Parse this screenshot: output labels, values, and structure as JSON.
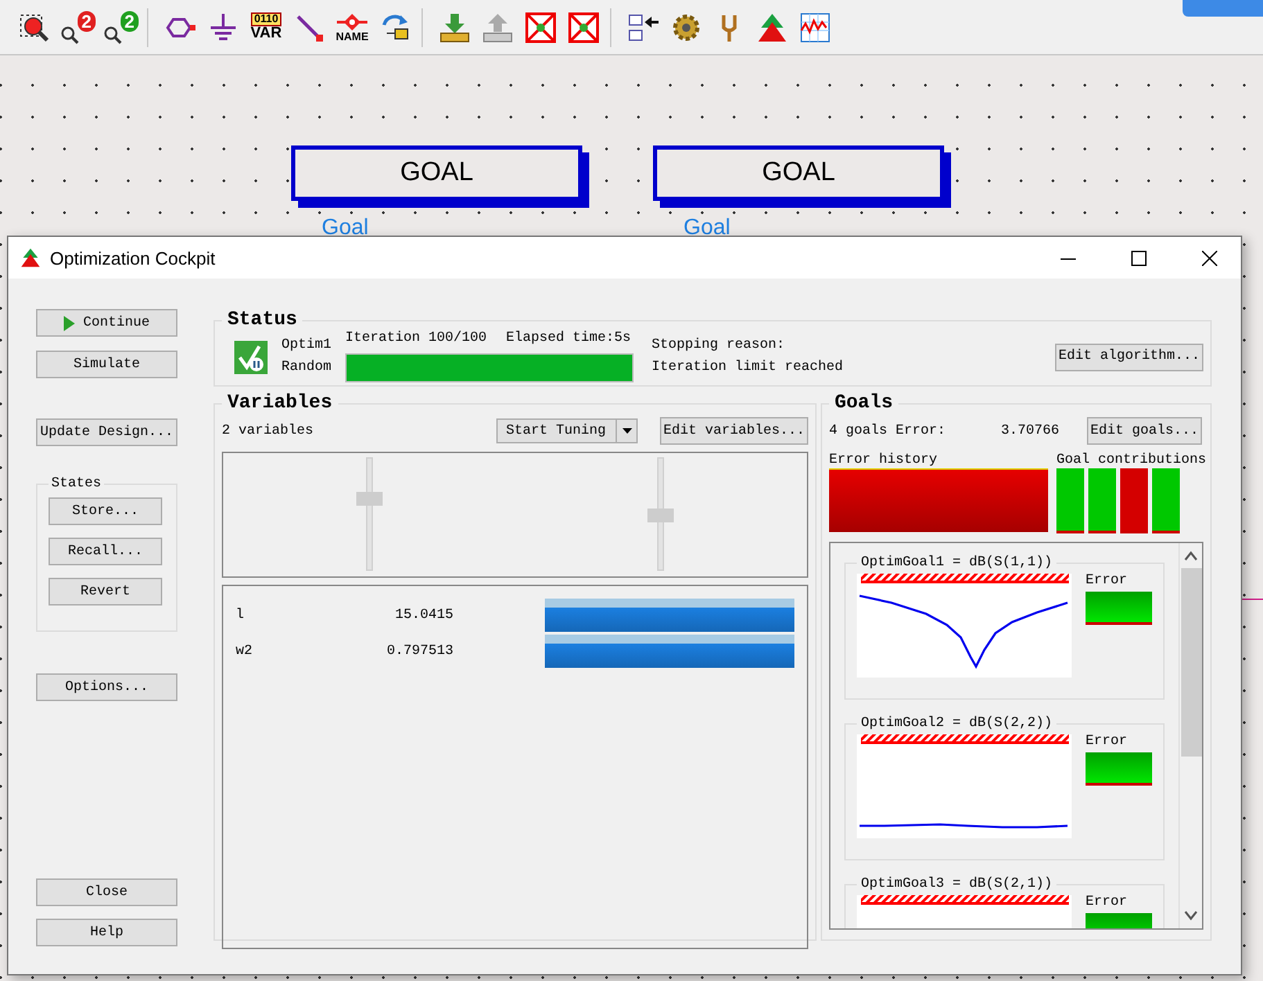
{
  "toolbar": {
    "groups": [
      [
        {
          "kind": "zoom-fit"
        },
        {
          "kind": "zoom-in",
          "labels": [
            "2"
          ]
        },
        {
          "kind": "zoom-out",
          "labels": [
            "2"
          ]
        }
      ],
      [
        {
          "kind": "port"
        },
        {
          "kind": "ground"
        },
        {
          "kind": "var",
          "labels": [
            "0110",
            "VAR"
          ]
        },
        {
          "kind": "wire"
        },
        {
          "kind": "name",
          "labels": [
            "NAME"
          ]
        },
        {
          "kind": "swap"
        }
      ],
      [
        {
          "kind": "import"
        },
        {
          "kind": "export"
        },
        {
          "kind": "deactivate"
        },
        {
          "kind": "deactivate-alt"
        }
      ],
      [
        {
          "kind": "compare"
        },
        {
          "kind": "gear"
        },
        {
          "kind": "tune"
        },
        {
          "kind": "optim"
        },
        {
          "kind": "plot"
        }
      ]
    ]
  },
  "canvas": {
    "components": [
      {
        "title": "GOAL",
        "label": "Goal"
      },
      {
        "title": "GOAL",
        "label": "Goal"
      }
    ]
  },
  "window": {
    "title": "Optimization Cockpit"
  },
  "side_buttons": [
    {
      "label": "Continue",
      "kind": "play"
    },
    {
      "label": "Simulate",
      "kind": "plain"
    },
    {
      "label": "Update Design...",
      "kind": "plain"
    }
  ],
  "states": {
    "title": "States",
    "buttons": [
      "Store...",
      "Recall...",
      "Revert"
    ]
  },
  "options_button": "Options...",
  "bottom_buttons": [
    "Close",
    "Help"
  ],
  "status": {
    "title": "Status",
    "optimizer": "Optim1",
    "algorithm": "Random",
    "iteration": "Iteration 100/100",
    "elapsed": "Elapsed time:5s",
    "level": 1,
    "stopping_label": "Stopping reason:",
    "stopping_reason": "Iteration limit reached",
    "edit_button": "Edit algorithm..."
  },
  "variables": {
    "title": "Variables",
    "count": "2 variables",
    "tuning": "Start Tuning",
    "edit_button": "Edit variables...",
    "sliders": [
      {
        "level": 0.67
      },
      {
        "level": 0.5
      }
    ],
    "rows": [
      {
        "name": "l",
        "value": "15.0415"
      },
      {
        "name": "w2",
        "value": "0.797513"
      }
    ]
  },
  "goals": {
    "title": "Goals",
    "count": "4 goals",
    "error_label": "Error:",
    "error_value": "3.70766",
    "edit_button": "Edit goals...",
    "history_label": "Error history",
    "contributions_label": "Goal contributions",
    "contributions": [
      {
        "color": "#00c800"
      },
      {
        "color": "#00c800"
      },
      {
        "color": "#d40000"
      },
      {
        "color": "#00c800"
      }
    ],
    "items": [
      {
        "title": "OptimGoal1 = dB(S(1,1))",
        "kind": "notch",
        "error_label": "Error"
      },
      {
        "title": "OptimGoal2 = dB(S(2,2))",
        "kind": "flat",
        "error_label": "Error"
      },
      {
        "title": "OptimGoal3 = dB(S(2,1))",
        "kind": "none",
        "error_label": "Error"
      }
    ]
  }
}
